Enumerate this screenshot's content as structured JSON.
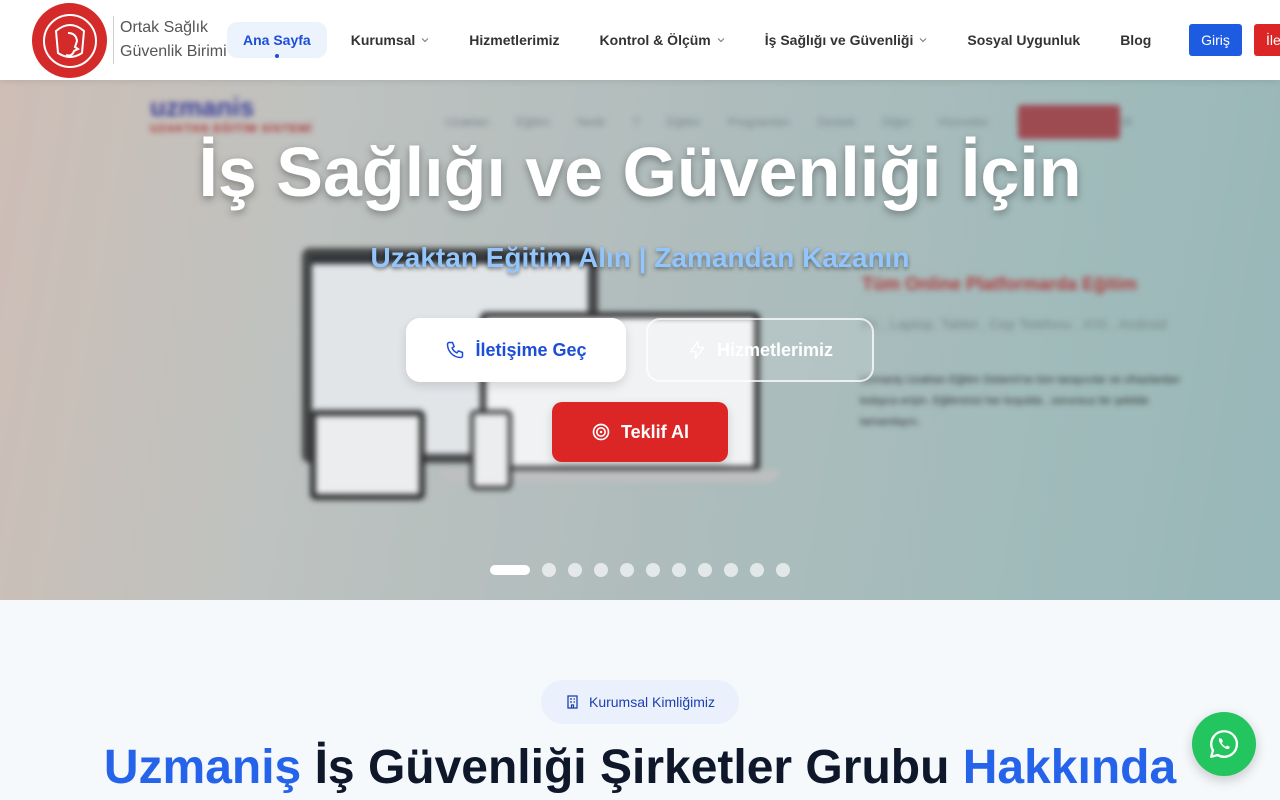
{
  "header": {
    "brand_line1": "Ortak Sağlık",
    "brand_line2": "Güvenlik Birimi",
    "nav": [
      {
        "label": "Ana Sayfa",
        "active": true,
        "dropdown": false
      },
      {
        "label": "Kurumsal",
        "active": false,
        "dropdown": true
      },
      {
        "label": "Hizmetlerimiz",
        "active": false,
        "dropdown": false
      },
      {
        "label": "Kontrol & Ölçüm",
        "active": false,
        "dropdown": true
      },
      {
        "label": "İş Sağlığı ve Güvenliği",
        "active": false,
        "dropdown": true
      },
      {
        "label": "Sosyal Uygunluk",
        "active": false,
        "dropdown": false
      },
      {
        "label": "Blog",
        "active": false,
        "dropdown": false
      }
    ],
    "login_label": "Giriş",
    "contact_label": "İletişim"
  },
  "hero": {
    "title": "İş Sağlığı ve Güvenliği İçin",
    "subtitle": "Uzaktan Eğitim Alın | Zamandan Kazanın",
    "call_button": "İletişime Geç",
    "services_button": "Hizmetlerimiz",
    "offer_button": "Teklif Al",
    "slide_count": 11,
    "active_slide": 1,
    "background": {
      "logo": "uzmanis",
      "logo_tagline": "UZAKTAN EĞİTİM SİSTEMİ",
      "nav": "Uzaktan Eğitim Nedir ? Eğitim Programları Destek Diğer Hizmetler UZMANİŞ OSGB",
      "headline": "Tüm Online Platformarda Eğitim",
      "devices": "Pc , Laptop, Tablet , Cep Telefonu , IOS , Android",
      "description": "Uzmaniş Uzaktan Eğitim Sistemi'ne tüm tarayıcılar ve cihazlardan kolayca erişin. Eğitiminizi her koşulda , sorunsuz bir şekilde tamamlayın."
    }
  },
  "about": {
    "badge": "Kurumsal Kimliğimiz",
    "title_part1": "Uzmaniş",
    "title_part2": " İş Güvenliği Şirketler Grubu ",
    "title_part3": "Hakkında"
  },
  "colors": {
    "primary": "#1d4ed8",
    "accent": "#dc2626",
    "whatsapp": "#22c55e"
  }
}
